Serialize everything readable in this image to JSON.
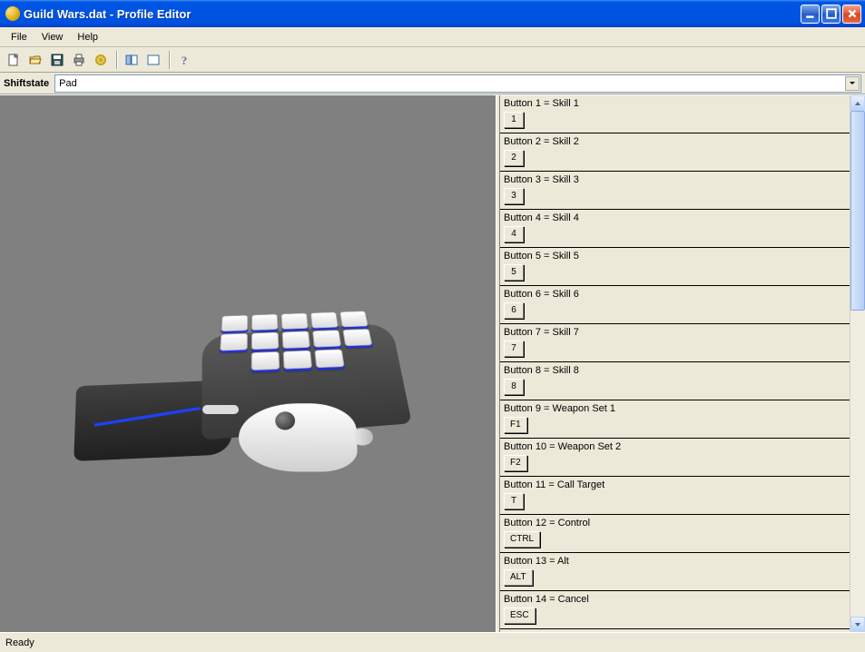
{
  "window": {
    "title": "Guild Wars.dat - Profile Editor"
  },
  "menubar": {
    "items": [
      "File",
      "View",
      "Help"
    ]
  },
  "toolbar": {
    "icons": [
      "new-icon",
      "open-icon",
      "save-icon",
      "print-icon",
      "build-icon",
      "layout-a-icon",
      "layout-b-icon",
      "help-icon"
    ]
  },
  "shiftstate": {
    "label": "Shiftstate",
    "value": "Pad"
  },
  "mappings": [
    {
      "label": "Button 1 = Skill 1",
      "key": "1"
    },
    {
      "label": "Button 2 = Skill 2",
      "key": "2"
    },
    {
      "label": "Button 3 = Skill 3",
      "key": "3"
    },
    {
      "label": "Button 4 = Skill 4",
      "key": "4"
    },
    {
      "label": "Button 5 = Skill 5",
      "key": "5"
    },
    {
      "label": "Button 6 = Skill 6",
      "key": "6"
    },
    {
      "label": "Button 7 = Skill 7",
      "key": "7"
    },
    {
      "label": "Button 8 = Skill 8",
      "key": "8"
    },
    {
      "label": "Button 9 = Weapon Set 1",
      "key": "F1"
    },
    {
      "label": "Button 10 = Weapon Set 2",
      "key": "F2"
    },
    {
      "label": "Button 11 = Call Target",
      "key": "T"
    },
    {
      "label": "Button 12 = Control",
      "key": "CTRL"
    },
    {
      "label": "Button 13 = Alt",
      "key": "ALT"
    },
    {
      "label": "Button 14 = Cancel",
      "key": "ESC"
    }
  ],
  "statusbar": {
    "text": "Ready"
  }
}
